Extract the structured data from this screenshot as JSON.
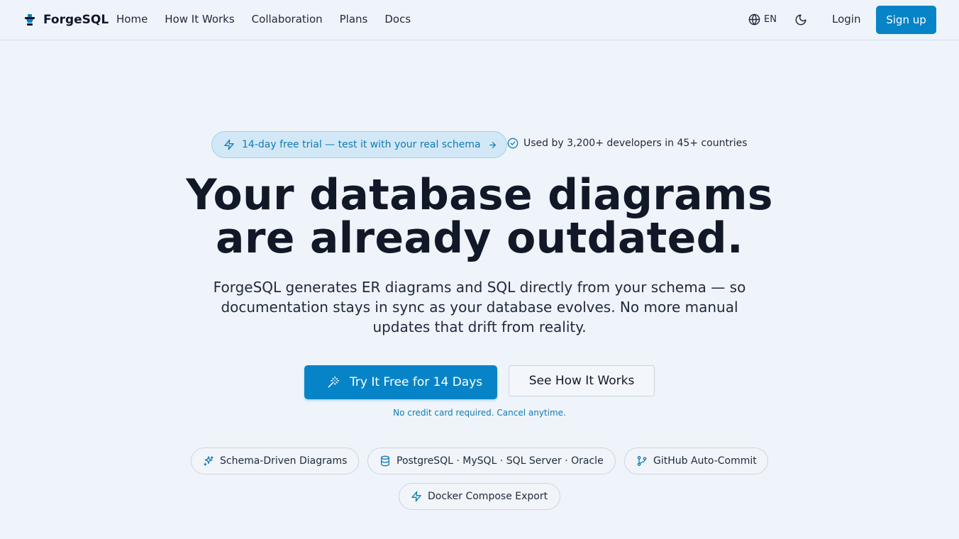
{
  "nav": {
    "brand": "ForgeSQL",
    "links": [
      "Home",
      "How It Works",
      "Collaboration",
      "Plans",
      "Docs"
    ],
    "language": "EN",
    "login": "Login",
    "signup": "Sign up"
  },
  "hero": {
    "trial_badge": "14-day free trial — test it with your real schema",
    "social_proof": "Used by 3,200+ developers in 45+ countries",
    "headline_line1": "Your database diagrams",
    "headline_line2": "are already outdated.",
    "subheadline": "ForgeSQL generates ER diagrams and SQL directly from your schema — so documentation stays in sync as your database evolves. No more manual updates that drift from reality.",
    "cta_primary": "Try It Free for 14 Days",
    "cta_secondary": "See How It Works",
    "cta_note": "No credit card required. Cancel anytime."
  },
  "features": [
    {
      "label": "Schema-Driven Diagrams",
      "icon": "sparkles-icon"
    },
    {
      "label": "PostgreSQL · MySQL · SQL Server · Oracle",
      "icon": "database-icon"
    },
    {
      "label": "GitHub Auto-Commit",
      "icon": "git-branch-icon"
    },
    {
      "label": "Docker Compose Export",
      "icon": "zap-icon"
    }
  ],
  "colors": {
    "background": "#eff4fa",
    "accent": "#0784c7",
    "badge_bg": "#d3e8f6",
    "text_dark": "#111827"
  }
}
